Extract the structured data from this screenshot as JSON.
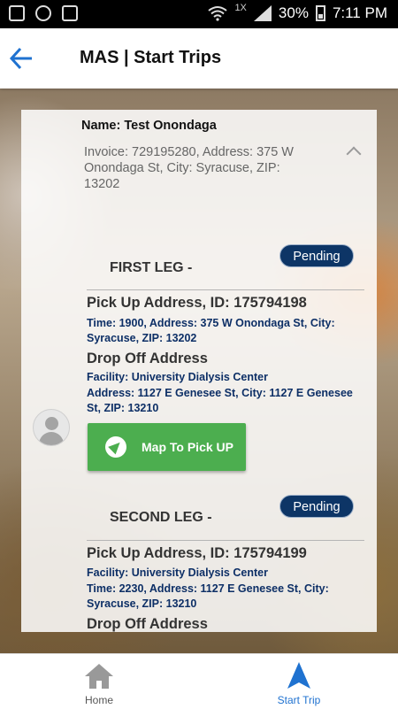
{
  "status_bar": {
    "network_label": "1X",
    "battery_percent": "30%",
    "time": "7:11 PM",
    "icons": [
      "help-icon",
      "location-icon",
      "image-icon",
      "wifi-icon",
      "signal-icon",
      "battery-icon"
    ]
  },
  "header": {
    "title": "MAS | Start Trips",
    "back_icon": "arrow-left-icon"
  },
  "card": {
    "name_line": "Name: Test Onondaga",
    "invoice_line": "Invoice: 729195280, Address: 375 W Onondaga St, City: Syracuse, ZIP: 13202",
    "expanded": true,
    "legs": [
      {
        "title": "FIRST LEG -",
        "status": "Pending",
        "pickup_heading": "Pick Up Address, ID: 175794198",
        "pickup_details": "Time: 1900, Address: 375 W Onondaga St, City: Syracuse, ZIP: 13202",
        "dropoff_heading": "Drop Off Address",
        "facility": "Facility:  University Dialysis Center",
        "dropoff_details": "Address: 1127 E Genesee St, City: 1127 E Genesee St, ZIP: 13210",
        "map_button": "Map To Pick UP"
      },
      {
        "title": "SECOND LEG -",
        "status": "Pending",
        "pickup_heading": "Pick Up Address, ID: 175794199",
        "facility": "Facility:  University Dialysis Center",
        "pickup_details": "Time: 2230, Address: 1127 E Genesee St, City: Syracuse, ZIP: 13210",
        "dropoff_heading": "Drop Off Address"
      }
    ]
  },
  "bottom_nav": {
    "items": [
      {
        "label": "Home",
        "icon": "home-icon",
        "active": false
      },
      {
        "label": "Start Trip",
        "icon": "navigation-arrow-icon",
        "active": true
      }
    ]
  },
  "colors": {
    "accent_blue": "#1f72d0",
    "pending_badge": "#0d3566",
    "map_button_green": "#4cae4f",
    "detail_text": "#0d2f66"
  }
}
